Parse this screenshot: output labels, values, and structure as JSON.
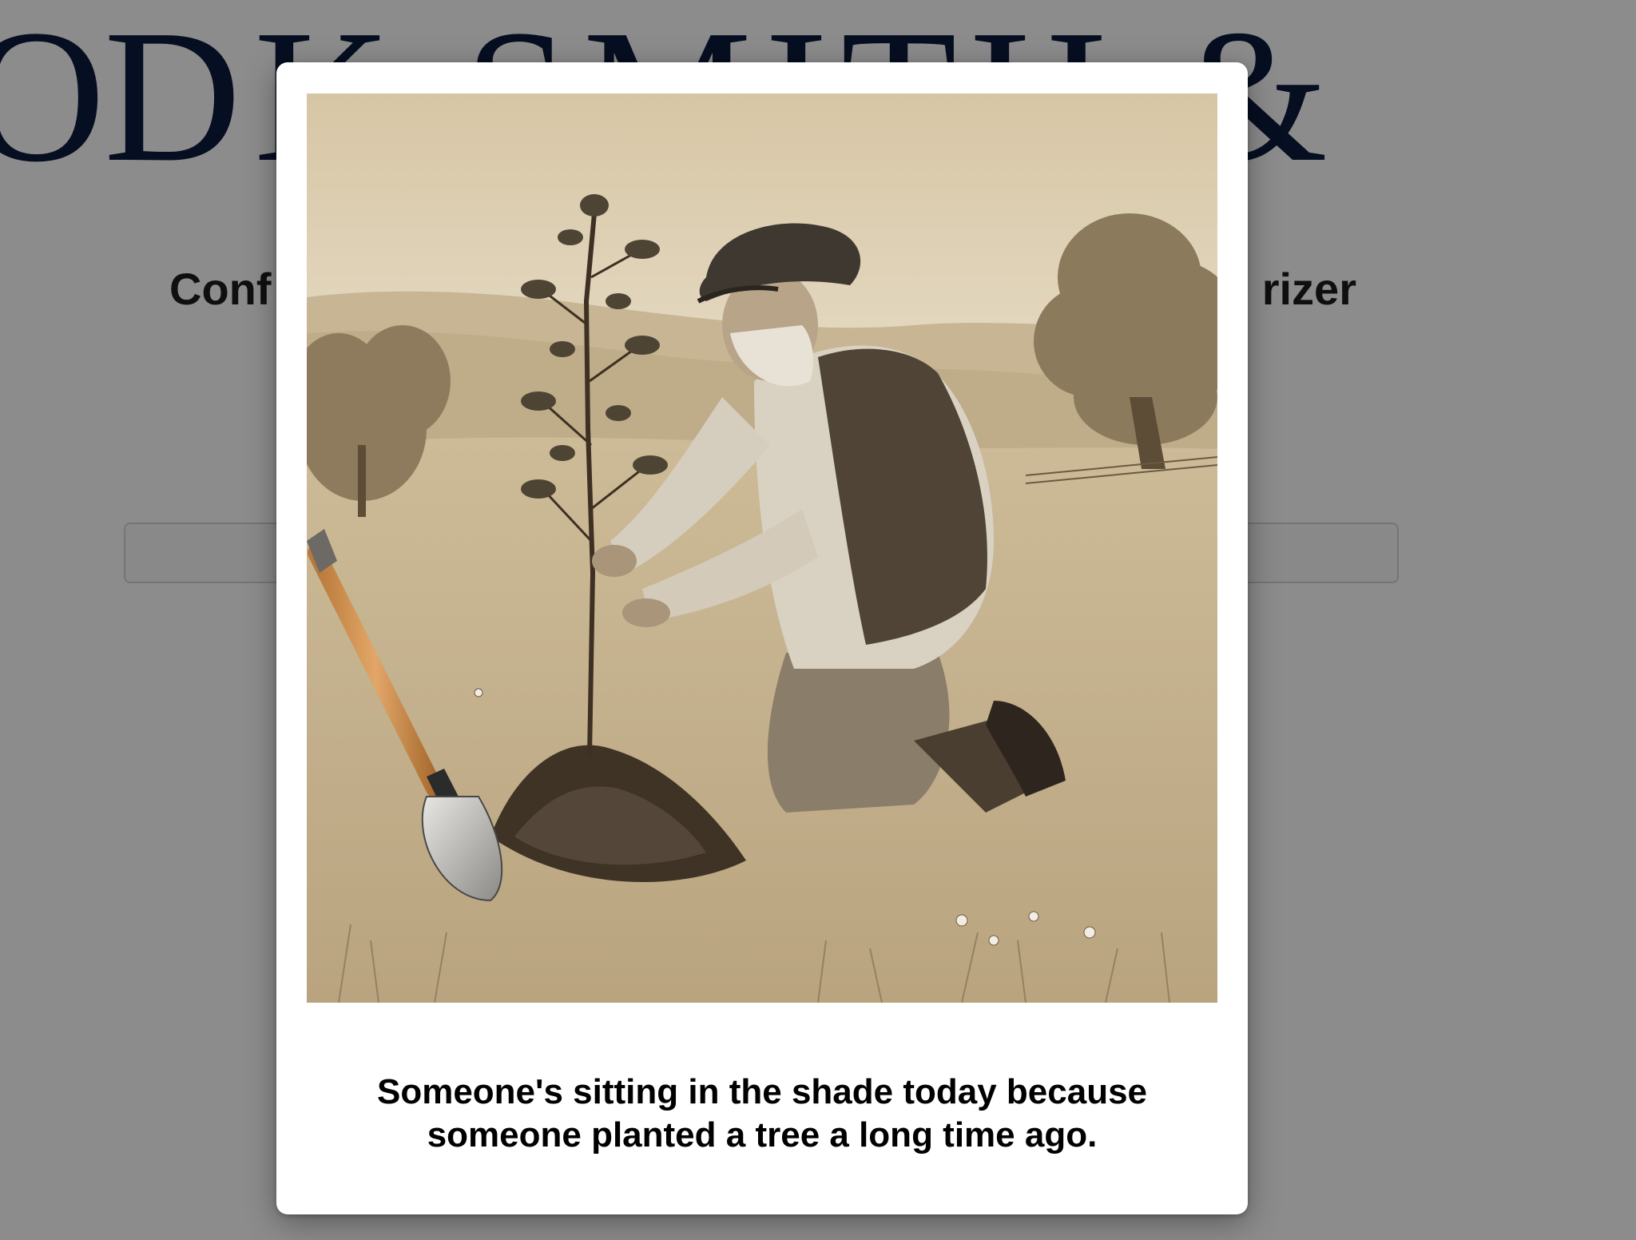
{
  "header": {
    "logo_text": "DK SMITH &",
    "logo_lead_glyph": "O"
  },
  "page": {
    "heading_left": "Conf",
    "heading_right": "rizer"
  },
  "modal": {
    "illustration_icon": "tree-planting-illustration",
    "quote_line_1": "Someone's sitting in the shade today because",
    "quote_line_2": "someone planted a tree a long time ago."
  },
  "colors": {
    "logo_navy": "#0c1b3d",
    "overlay": "#8a8a8a",
    "modal_bg": "#ffffff",
    "illustration_sepia": "#d8c7a7"
  }
}
